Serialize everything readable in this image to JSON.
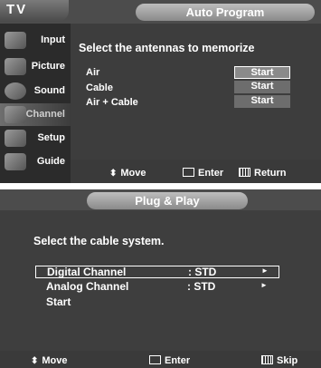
{
  "panel1": {
    "brand": "TV",
    "title": "Auto Program",
    "sidebar": [
      {
        "label": "Input",
        "icon": "input-icon"
      },
      {
        "label": "Picture",
        "icon": "picture-icon"
      },
      {
        "label": "Sound",
        "icon": "sound-icon"
      },
      {
        "label": "Channel",
        "icon": "channel-icon"
      },
      {
        "label": "Setup",
        "icon": "setup-icon"
      },
      {
        "label": "Guide",
        "icon": "guide-icon"
      }
    ],
    "instruction": "Select the antennas to memorize",
    "options": [
      {
        "label": "Air",
        "button": "Start"
      },
      {
        "label": "Cable",
        "button": "Start"
      },
      {
        "label": "Air + Cable",
        "button": "Start"
      }
    ],
    "footer": {
      "move": "Move",
      "enter": "Enter",
      "return": "Return"
    }
  },
  "panel2": {
    "title": "Plug & Play",
    "instruction": "Select the cable system.",
    "rows": [
      {
        "name": "Digital Channel",
        "value": ": STD",
        "arrow": "►"
      },
      {
        "name": "Analog Channel",
        "value": ": STD",
        "arrow": "►"
      },
      {
        "name": "Start",
        "value": "",
        "arrow": ""
      }
    ],
    "footer": {
      "move": "Move",
      "enter": "Enter",
      "skip": "Skip"
    }
  }
}
